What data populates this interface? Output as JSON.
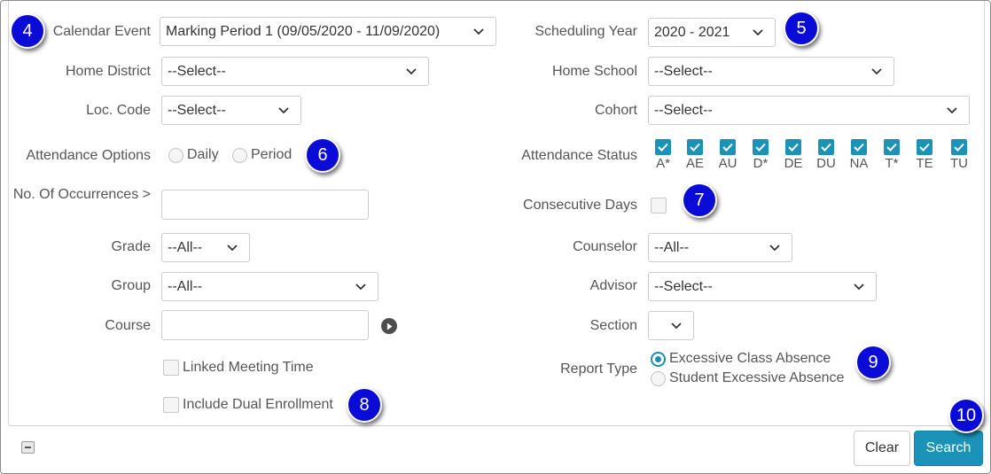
{
  "form": {
    "calendar_event": {
      "label": "Calendar Event",
      "value": "Marking Period 1 (09/05/2020 - 11/09/2020)"
    },
    "scheduling_year": {
      "label": "Scheduling Year",
      "value": "2020 - 2021"
    },
    "home_district": {
      "label": "Home District",
      "value": "--Select--"
    },
    "home_school": {
      "label": "Home School",
      "value": "--Select--"
    },
    "loc_code": {
      "label": "Loc. Code",
      "value": "--Select--"
    },
    "cohort": {
      "label": "Cohort",
      "value": "--Select--"
    },
    "attendance_options": {
      "label": "Attendance Options",
      "options": [
        "Daily",
        "Period"
      ]
    },
    "attendance_status": {
      "label": "Attendance Status",
      "codes": [
        "A*",
        "AE",
        "AU",
        "D*",
        "DE",
        "DU",
        "NA",
        "T*",
        "TE",
        "TU"
      ]
    },
    "occurrences": {
      "label": "No. Of Occurrences >",
      "value": ""
    },
    "consecutive_days": {
      "label": "Consecutive Days",
      "checked": false
    },
    "grade": {
      "label": "Grade",
      "value": "--All--"
    },
    "counselor": {
      "label": "Counselor",
      "value": "--All--"
    },
    "group": {
      "label": "Group",
      "value": "--All--"
    },
    "advisor": {
      "label": "Advisor",
      "value": "--Select--"
    },
    "course": {
      "label": "Course",
      "value": ""
    },
    "section": {
      "label": "Section",
      "value": ""
    },
    "linked_meeting_time": {
      "label": "Linked Meeting Time",
      "checked": false
    },
    "include_dual_enrollment": {
      "label": "Include Dual Enrollment",
      "checked": false
    },
    "report_type": {
      "label": "Report Type",
      "options": [
        "Excessive Class Absence",
        "Student Excessive Absence"
      ],
      "selected": "Excessive Class Absence"
    }
  },
  "callouts": [
    "4",
    "5",
    "6",
    "7",
    "8",
    "9",
    "10"
  ],
  "footer": {
    "clear_label": "Clear",
    "search_label": "Search"
  },
  "colors": {
    "accent": "#1b93b8",
    "callout": "#0b0bd8"
  },
  "icons": {
    "dropdown": "chevron-down-icon",
    "check": "check-icon",
    "play": "play-icon",
    "collapse": "minus-icon"
  }
}
